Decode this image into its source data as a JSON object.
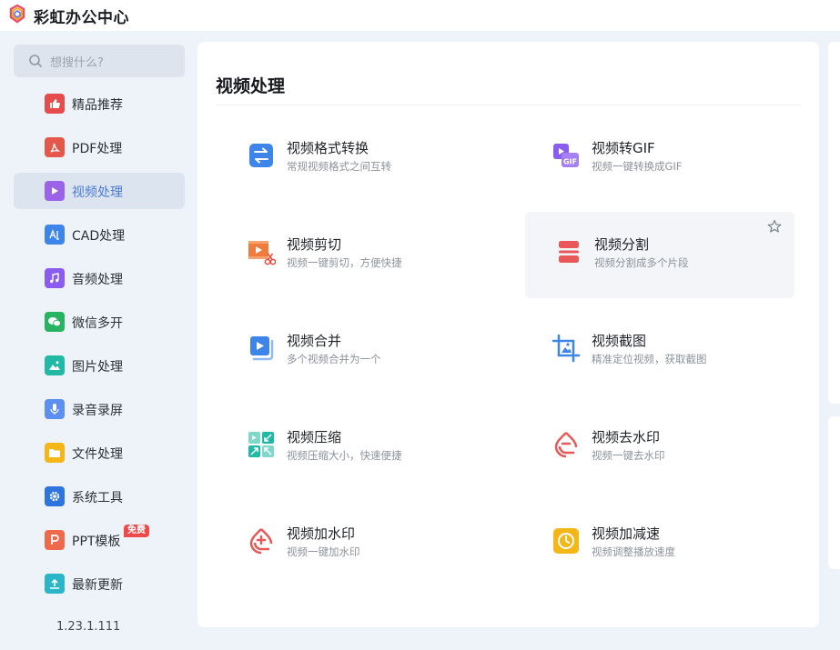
{
  "app": {
    "title": "彩虹办公中心"
  },
  "search": {
    "placeholder": "想搜什么?"
  },
  "sidebar": {
    "items": [
      {
        "label": "精品推荐",
        "icon": "thumbs-up-icon",
        "color": "#e64c4c"
      },
      {
        "label": "PDF处理",
        "icon": "pdf-icon",
        "color": "#e5574a"
      },
      {
        "label": "视频处理",
        "icon": "play-icon",
        "color": "#9a63e8",
        "active": true
      },
      {
        "label": "CAD处理",
        "icon": "cad-icon",
        "color": "#3d85e8"
      },
      {
        "label": "音频处理",
        "icon": "music-note-icon",
        "color": "#8b5cf0"
      },
      {
        "label": "微信多开",
        "icon": "wechat-icon",
        "color": "#26b463"
      },
      {
        "label": "图片处理",
        "icon": "image-icon",
        "color": "#21b9a6"
      },
      {
        "label": "录音录屏",
        "icon": "microphone-icon",
        "color": "#5b8ff0"
      },
      {
        "label": "文件处理",
        "icon": "folder-icon",
        "color": "#f5b617"
      },
      {
        "label": "系统工具",
        "icon": "gear-icon",
        "color": "#2d74df"
      },
      {
        "label": "PPT模板",
        "icon": "ppt-icon",
        "color": "#ef6a4b",
        "badge": "免费"
      },
      {
        "label": "最新更新",
        "icon": "upload-icon",
        "color": "#2ab5c8"
      }
    ],
    "version": "1.23.1.111"
  },
  "main": {
    "title": "视频处理",
    "cards": [
      {
        "title": "视频格式转换",
        "desc": "常规视频格式之间互转",
        "icon": "swap-arrows-icon"
      },
      {
        "title": "视频转GIF",
        "desc": "视频一键转换成GIF",
        "icon": "gif-icon"
      },
      {
        "title": "视频剪切",
        "desc": "视频一键剪切，方便快捷",
        "icon": "video-cut-icon"
      },
      {
        "title": "视频分割",
        "desc": "视频分割成多个片段",
        "icon": "split-icon"
      },
      {
        "title": "视频合并",
        "desc": "多个视频合并为一个",
        "icon": "video-merge-icon"
      },
      {
        "title": "视频截图",
        "desc": "精准定位视频，获取截图",
        "icon": "crop-image-icon"
      },
      {
        "title": "视频压缩",
        "desc": "视频压缩大小，快速便捷",
        "icon": "compress-icon"
      },
      {
        "title": "视频去水印",
        "desc": "视频一键去水印",
        "icon": "remove-watermark-icon"
      },
      {
        "title": "视频加水印",
        "desc": "视频一键加水印",
        "icon": "add-watermark-icon"
      },
      {
        "title": "视频加减速",
        "desc": "视频调整播放速度",
        "icon": "speed-icon"
      }
    ]
  }
}
